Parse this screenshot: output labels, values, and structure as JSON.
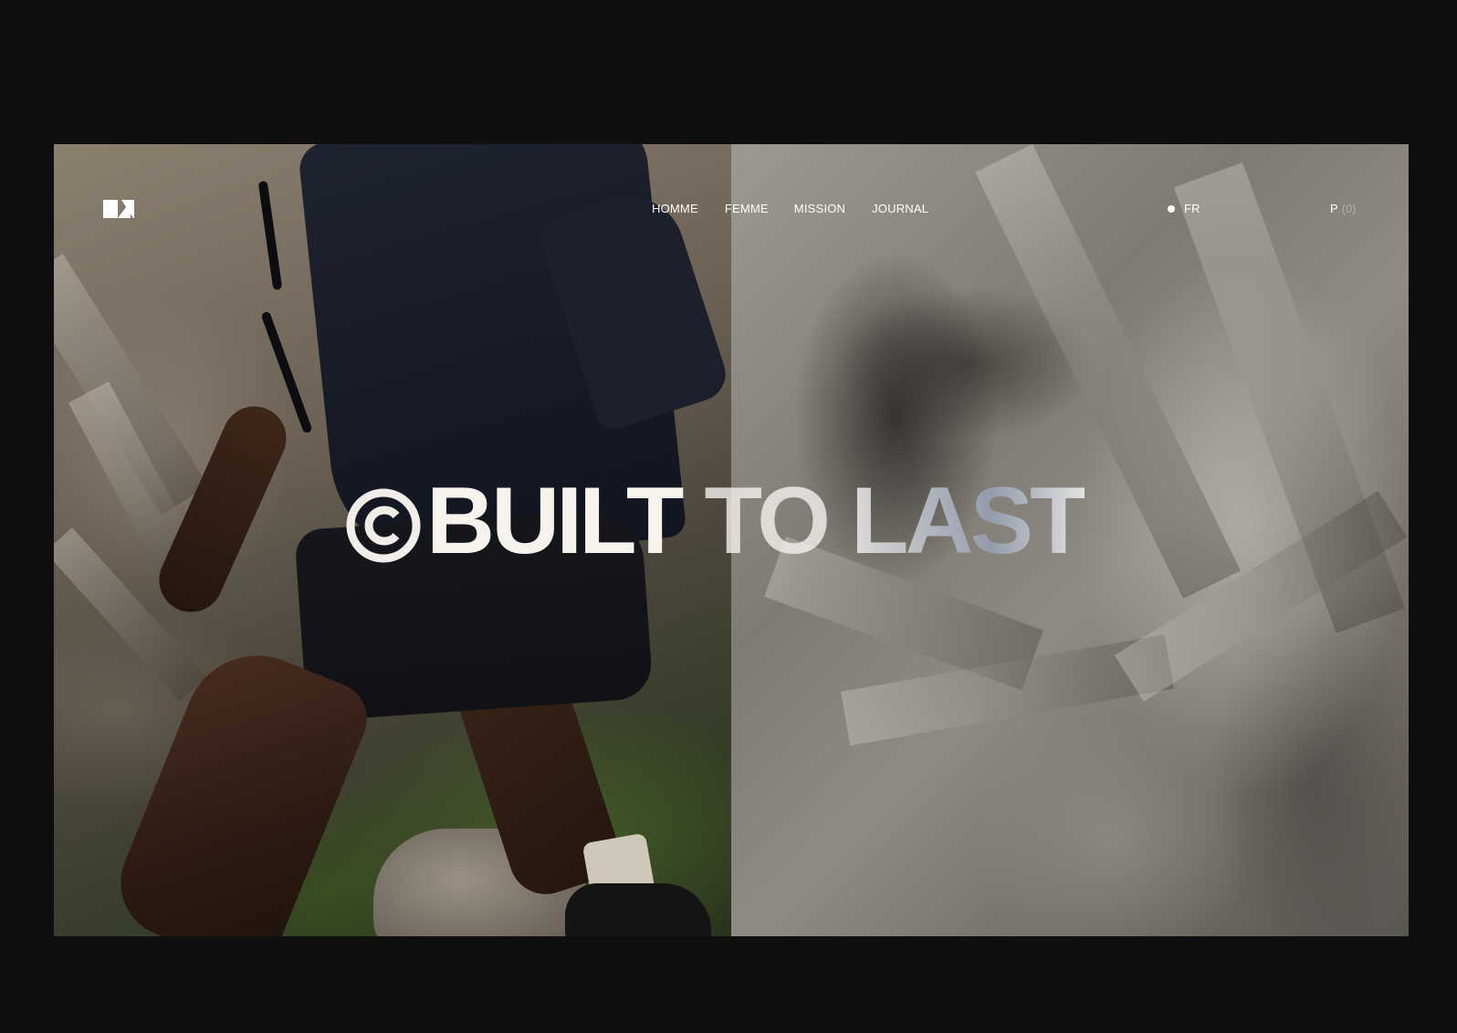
{
  "nav": {
    "items": [
      {
        "label": "HOMME"
      },
      {
        "label": "FEMME"
      },
      {
        "label": "MISSION"
      },
      {
        "label": "JOURNAL"
      }
    ]
  },
  "language": {
    "label": "FR"
  },
  "cart": {
    "label": "P",
    "count": "0"
  },
  "hero": {
    "headline_part1": "BUILT",
    "headline_part2": "TO",
    "headline_part3": "LAST"
  },
  "colors": {
    "page_background": "#0f0f10",
    "text": "#ffffff",
    "headline": "#f3efea"
  },
  "icons": {
    "logo": "brand-logo-icon",
    "copyright": "copyright-icon",
    "language_indicator": "dot-icon"
  }
}
